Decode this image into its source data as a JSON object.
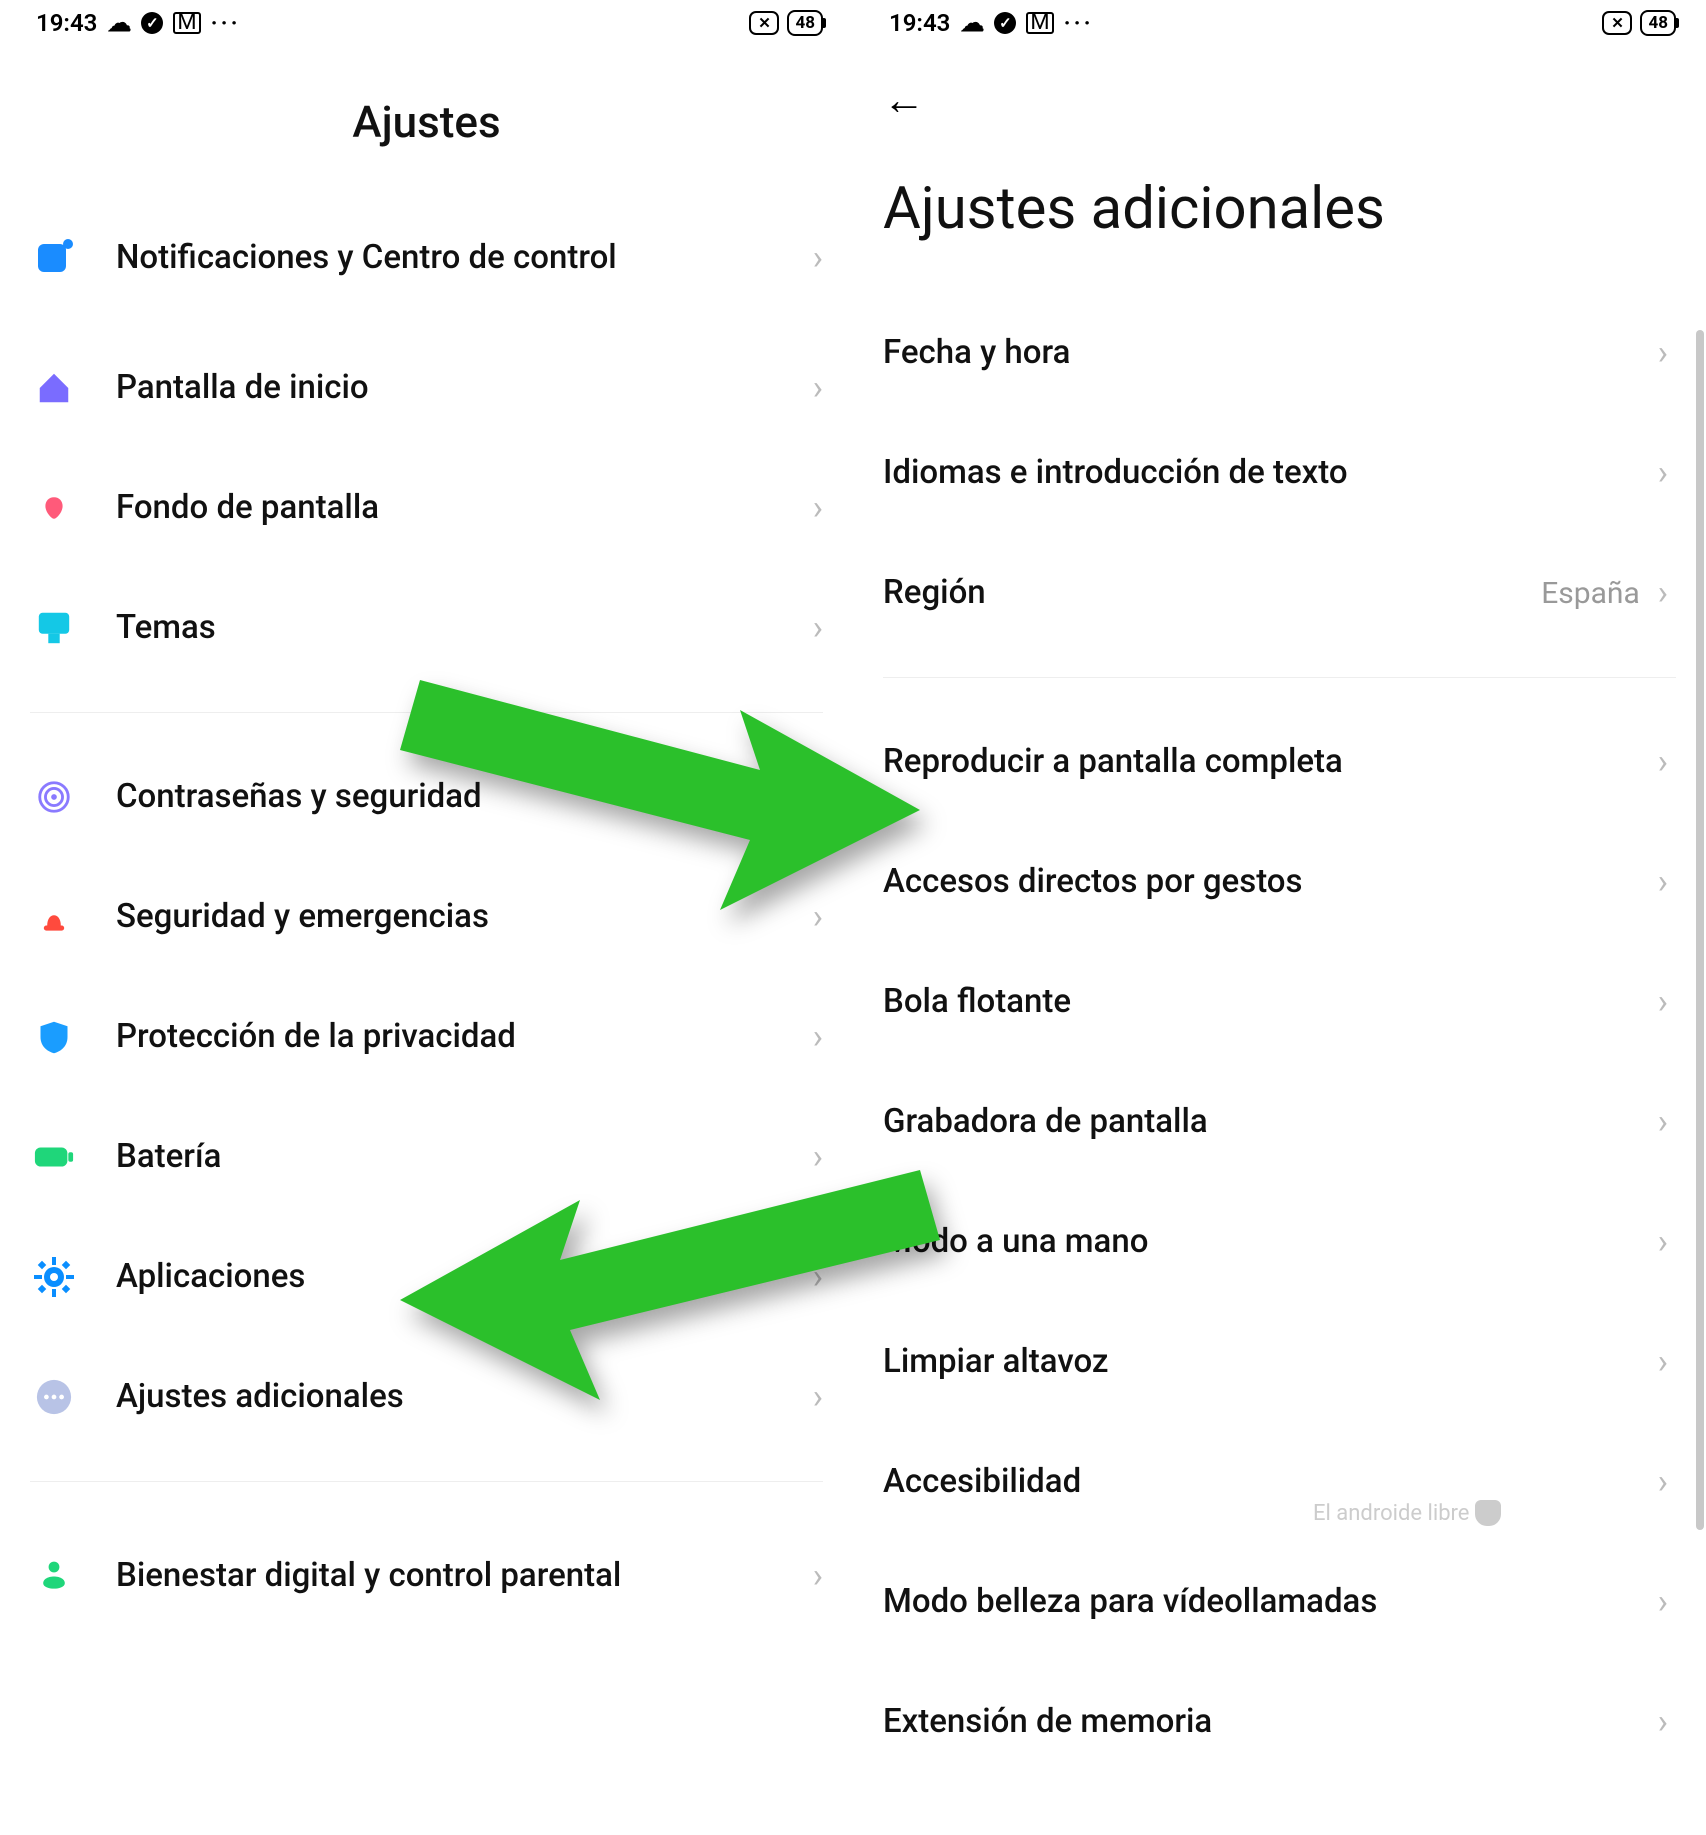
{
  "status": {
    "time": "19:43",
    "battery": "48"
  },
  "left": {
    "title": "Ajustes",
    "items": [
      {
        "label": "Notificaciones y Centro de control"
      },
      {
        "label": "Pantalla de inicio"
      },
      {
        "label": "Fondo de pantalla"
      },
      {
        "label": "Temas"
      },
      {
        "label": "Contraseñas y seguridad"
      },
      {
        "label": "Seguridad y emergencias"
      },
      {
        "label": "Protección de la privacidad"
      },
      {
        "label": "Batería"
      },
      {
        "label": "Aplicaciones"
      },
      {
        "label": "Ajustes adicionales"
      },
      {
        "label": "Bienestar digital y control parental"
      }
    ]
  },
  "right": {
    "title": "Ajustes adicionales",
    "region_value": "España",
    "items_top": [
      {
        "label": "Fecha y hora"
      },
      {
        "label": "Idiomas e introducción de texto"
      },
      {
        "label": "Región"
      }
    ],
    "items_bottom": [
      {
        "label": "Reproducir a pantalla completa"
      },
      {
        "label": "Accesos directos por gestos"
      },
      {
        "label": "Bola flotante"
      },
      {
        "label": "Grabadora de pantalla"
      },
      {
        "label": "Modo a una mano"
      },
      {
        "label": "Limpiar altavoz"
      },
      {
        "label": "Accesibilidad"
      },
      {
        "label": "Modo belleza para vídeollamadas"
      },
      {
        "label": "Extensión de memoria"
      }
    ]
  },
  "watermark": "El androide libre"
}
